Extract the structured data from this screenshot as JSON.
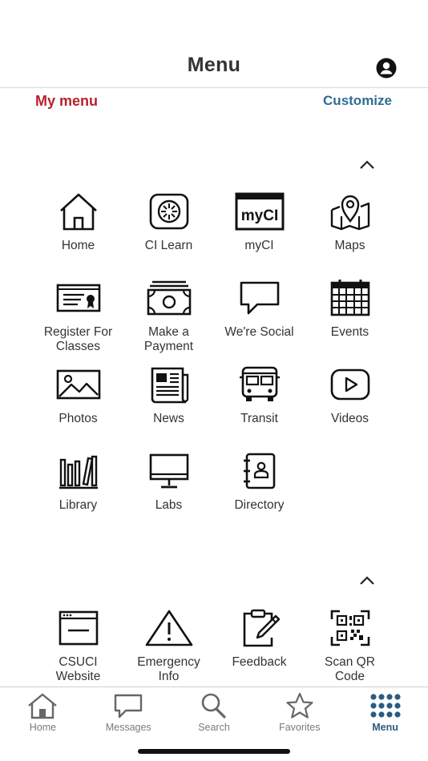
{
  "header": {
    "title": "Menu"
  },
  "mymenu": {
    "label": "My menu",
    "customize_label": "Customize"
  },
  "section1": {
    "tiles": [
      {
        "label": "Home",
        "icon": "home-icon"
      },
      {
        "label": "CI Learn",
        "icon": "canvas-icon"
      },
      {
        "label": "myCI",
        "icon": "myci-logo-icon",
        "logo_text": "myCI"
      },
      {
        "label": "Maps",
        "icon": "map-icon"
      },
      {
        "label": "Register For Classes",
        "icon": "certificate-icon"
      },
      {
        "label": "Make a Payment",
        "icon": "money-icon"
      },
      {
        "label": "We're Social",
        "icon": "speech-bubble-icon"
      },
      {
        "label": "Events",
        "icon": "calendar-icon"
      },
      {
        "label": "Photos",
        "icon": "photo-icon"
      },
      {
        "label": "News",
        "icon": "newspaper-icon"
      },
      {
        "label": "Transit",
        "icon": "bus-icon"
      },
      {
        "label": "Videos",
        "icon": "play-icon"
      },
      {
        "label": "Library",
        "icon": "library-icon"
      },
      {
        "label": "Labs",
        "icon": "monitor-icon"
      },
      {
        "label": "Directory",
        "icon": "address-book-icon"
      }
    ]
  },
  "section2": {
    "tiles": [
      {
        "label": "CSUCI Website",
        "icon": "browser-icon"
      },
      {
        "label": "Emergency Info",
        "icon": "warning-icon"
      },
      {
        "label": "Feedback",
        "icon": "clipboard-pen-icon"
      },
      {
        "label": "Scan QR Code",
        "icon": "qr-code-icon"
      }
    ]
  },
  "tabbar": {
    "tabs": [
      {
        "label": "Home",
        "icon": "home-icon"
      },
      {
        "label": "Messages",
        "icon": "chat-icon"
      },
      {
        "label": "Search",
        "icon": "search-icon"
      },
      {
        "label": "Favorites",
        "icon": "star-icon"
      },
      {
        "label": "Menu",
        "icon": "grid-dots-icon",
        "active": true
      }
    ]
  },
  "colors": {
    "mymenu": "#b5222c",
    "accent": "#2e6d92",
    "active_tab": "#2b5b80",
    "inactive_tab": "#7a7a7a"
  }
}
